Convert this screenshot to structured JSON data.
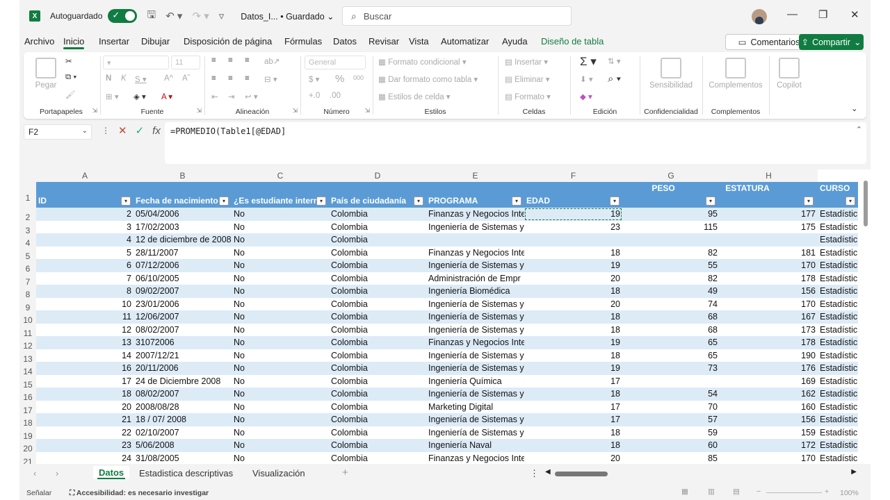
{
  "titlebar": {
    "app_icon": "X",
    "autosave_label": "Autoguardado",
    "doc_name": "Datos_I...",
    "saved_status": "• Guardado",
    "search_placeholder": "Buscar"
  },
  "menu": {
    "tabs": [
      "Archivo",
      "Inicio",
      "Insertar",
      "Dibujar",
      "Disposición de página",
      "Fórmulas",
      "Datos",
      "Revisar",
      "Vista",
      "Automatizar",
      "Ayuda",
      "Diseño de tabla"
    ],
    "active_tab": "Inicio",
    "comments_label": "Comentarios",
    "share_label": "Compartir"
  },
  "ribbon": {
    "portapapeles": {
      "label": "Portapapeles",
      "paste": "Pegar"
    },
    "fuente": {
      "label": "Fuente",
      "size": "11"
    },
    "alineacion": {
      "label": "Alineación"
    },
    "numero": {
      "label": "Número",
      "format": "General"
    },
    "estilos": {
      "label": "Estilos",
      "cond": "Formato condicional",
      "table": "Dar formato como tabla",
      "cell": "Estilos de celda"
    },
    "celdas": {
      "label": "Celdas",
      "insert": "Insertar",
      "delete": "Eliminar",
      "format": "Formato"
    },
    "edicion": {
      "label": "Edición"
    },
    "confidencialidad": {
      "label": "Confidencialidad",
      "btn": "Sensibilidad"
    },
    "complementos": {
      "label": "Complementos",
      "btn": "Complementos"
    },
    "copilot": {
      "btn": "Copilot"
    }
  },
  "formula_bar": {
    "name_box": "F2",
    "formula": "=PROMEDIO(Table1[@EDAD]"
  },
  "grid": {
    "columns": [
      "A",
      "B",
      "C",
      "D",
      "E",
      "F",
      "G",
      "H"
    ],
    "header_top": {
      "peso": "PESO",
      "estatura": "ESTATURA",
      "curso": "CURSO"
    },
    "header": [
      "ID",
      "Fecha de nacimiento",
      "¿Es estudiante intern",
      "País de ciudadanía",
      "PROGRAMA",
      "EDAD"
    ],
    "rows": [
      {
        "n": "2",
        "id": "2",
        "fecha": "05/04/2006",
        "est": "No",
        "pais": "Colombia",
        "prog": "Finanzas y Negocios Inte",
        "edad": "19",
        "peso": "95",
        "estatura": "177",
        "curso": "Estadístic"
      },
      {
        "n": "3",
        "id": "3",
        "fecha": "17/02/2003",
        "est": "No",
        "pais": "Colombia",
        "prog": "Ingeniería de Sistemas y",
        "edad": "23",
        "peso": "115",
        "estatura": "175",
        "curso": "Estadístic"
      },
      {
        "n": "4",
        "id": "4",
        "fecha": "12 de diciembre de 2008",
        "est": "No",
        "pais": "Colombia",
        "prog": "",
        "edad": "",
        "peso": "",
        "estatura": "",
        "curso": "Estadístic"
      },
      {
        "n": "5",
        "id": "5",
        "fecha": "28/11/2007",
        "est": "No",
        "pais": "Colombia",
        "prog": "Finanzas y Negocios Inte",
        "edad": "18",
        "peso": "82",
        "estatura": "181",
        "curso": "Estadístic"
      },
      {
        "n": "6",
        "id": "6",
        "fecha": "07/12/2006",
        "est": "No",
        "pais": "Colombia",
        "prog": "Ingeniería de Sistemas y",
        "edad": "19",
        "peso": "55",
        "estatura": "170",
        "curso": "Estadístic"
      },
      {
        "n": "7",
        "id": "7",
        "fecha": "06/10/2005",
        "est": "No",
        "pais": "Colombia",
        "prog": "Administración de Empr",
        "edad": "20",
        "peso": "82",
        "estatura": "178",
        "curso": "Estadístic"
      },
      {
        "n": "8",
        "id": "8",
        "fecha": "09/02/2007",
        "est": "No",
        "pais": "Colombia",
        "prog": "Ingeniería Biomédica",
        "edad": "18",
        "peso": "49",
        "estatura": "156",
        "curso": "Estadístic"
      },
      {
        "n": "9",
        "id": "10",
        "fecha": "23/01/2006",
        "est": "No",
        "pais": "Colombia",
        "prog": "Ingeniería de Sistemas y",
        "edad": "20",
        "peso": "74",
        "estatura": "170",
        "curso": "Estadístic"
      },
      {
        "n": "10",
        "id": "11",
        "fecha": "12/06/2007",
        "est": "No",
        "pais": "Colombia",
        "prog": "Ingeniería de Sistemas y",
        "edad": "18",
        "peso": "68",
        "estatura": "167",
        "curso": "Estadístic"
      },
      {
        "n": "11",
        "id": "12",
        "fecha": "08/02/2007",
        "est": "No",
        "pais": "Colombia",
        "prog": "Ingeniería de Sistemas y",
        "edad": "18",
        "peso": "68",
        "estatura": "173",
        "curso": "Estadístic"
      },
      {
        "n": "12",
        "id": "13",
        "fecha": "31072006",
        "est": "No",
        "pais": "Colombia",
        "prog": "Finanzas y Negocios Inte",
        "edad": "19",
        "peso": "65",
        "estatura": "178",
        "curso": "Estadístic"
      },
      {
        "n": "13",
        "id": "14",
        "fecha": "2007/12/21",
        "est": "No",
        "pais": "Colombia",
        "prog": "Ingeniería de Sistemas y",
        "edad": "18",
        "peso": "65",
        "estatura": "190",
        "curso": "Estadístic"
      },
      {
        "n": "14",
        "id": "16",
        "fecha": "20/11/2006",
        "est": "No",
        "pais": "Colombia",
        "prog": "Ingeniería de Sistemas y",
        "edad": "19",
        "peso": "73",
        "estatura": "176",
        "curso": "Estadístic"
      },
      {
        "n": "15",
        "id": "17",
        "fecha": "24 de Diciembre 2008",
        "est": "No",
        "pais": "Colombia",
        "prog": "Ingeniería Química",
        "edad": "17",
        "peso": "",
        "estatura": "169",
        "curso": "Estadístic"
      },
      {
        "n": "16",
        "id": "18",
        "fecha": "08/02/2007",
        "est": "No",
        "pais": "Colombia",
        "prog": "Ingeniería de Sistemas y",
        "edad": "18",
        "peso": "54",
        "estatura": "162",
        "curso": "Estadístic"
      },
      {
        "n": "17",
        "id": "20",
        "fecha": "2008/08/28",
        "est": "No",
        "pais": "Colombia",
        "prog": "Marketing Digital",
        "edad": "17",
        "peso": "70",
        "estatura": "160",
        "curso": "Estadístic"
      },
      {
        "n": "18",
        "id": "21",
        "fecha": "18 / 07/ 2008",
        "est": "No",
        "pais": "Colombia",
        "prog": "Ingeniería de Sistemas y",
        "edad": "17",
        "peso": "57",
        "estatura": "156",
        "curso": "Estadístic"
      },
      {
        "n": "19",
        "id": "22",
        "fecha": "02/10/2007",
        "est": "No",
        "pais": "Colombia",
        "prog": "Ingeniería de Sistemas y",
        "edad": "18",
        "peso": "59",
        "estatura": "159",
        "curso": "Estadístic"
      },
      {
        "n": "20",
        "id": "23",
        "fecha": "5/06/2008",
        "est": "No",
        "pais": "Colombia",
        "prog": "Ingeniería Naval",
        "edad": "18",
        "peso": "60",
        "estatura": "172",
        "curso": "Estadístic"
      },
      {
        "n": "21",
        "id": "24",
        "fecha": "31/08/2005",
        "est": "No",
        "pais": "Colombia",
        "prog": "Finanzas y Negocios Inte",
        "edad": "20",
        "peso": "85",
        "estatura": "170",
        "curso": "Estadístic"
      }
    ]
  },
  "sheets": {
    "tabs": [
      "Datos",
      "Estadistica descriptivas",
      "Visualización"
    ],
    "active": "Datos"
  },
  "status": {
    "mode": "Señalar",
    "accessibility": "Accesibilidad: es necesario investigar",
    "zoom": "100%"
  },
  "colors": {
    "excel_green": "#107c41",
    "header_blue": "#5b9bd5",
    "band_blue": "#ddebf7"
  }
}
